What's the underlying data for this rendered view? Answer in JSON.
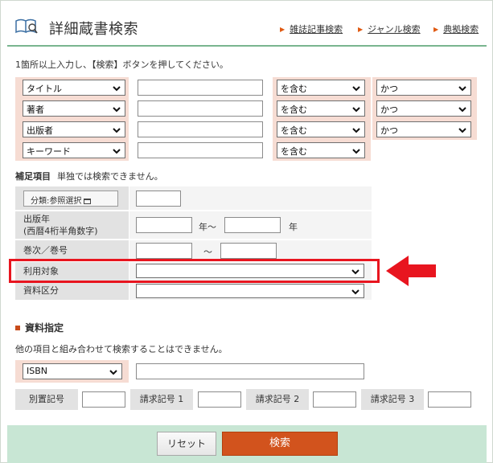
{
  "header": {
    "title": "詳細蔵書検索",
    "links": [
      "雑誌記事検索",
      "ジャンル検索",
      "典拠検索"
    ]
  },
  "instruction": "1箇所以上入力し、【検索】ボタンを押してください。",
  "search_rows": [
    {
      "field": "タイトル",
      "match": "を含む",
      "op": "かつ"
    },
    {
      "field": "著者",
      "match": "を含む",
      "op": "かつ"
    },
    {
      "field": "出版者",
      "match": "を含む",
      "op": "かつ"
    },
    {
      "field": "キーワード",
      "match": "を含む"
    }
  ],
  "supplement": {
    "title": "補足項目",
    "note": "単独では検索できません。",
    "classification_button": "分類:参照選択",
    "pub_year_label_1": "出版年",
    "pub_year_label_2": "(西暦4桁半角数字)",
    "pub_year_from_suffix": "年～",
    "pub_year_to_suffix": "年",
    "volume_label": "巻次／巻号",
    "volume_sep": "～",
    "audience_label": "利用対象",
    "material_label": "資料区分"
  },
  "material_spec": {
    "title": "資料指定",
    "note": "他の項目と組み合わせて検索することはできません。",
    "id_type": "ISBN",
    "call_labels": [
      "別置記号",
      "請求記号 1",
      "請求記号 2",
      "請求記号 3"
    ]
  },
  "buttons": {
    "reset": "リセット",
    "search": "検索"
  },
  "colors": {
    "accent": "#d2531d",
    "highlight": "#e8151f",
    "footer": "#c8e6d4",
    "row_bg": "#f6dcd3"
  }
}
